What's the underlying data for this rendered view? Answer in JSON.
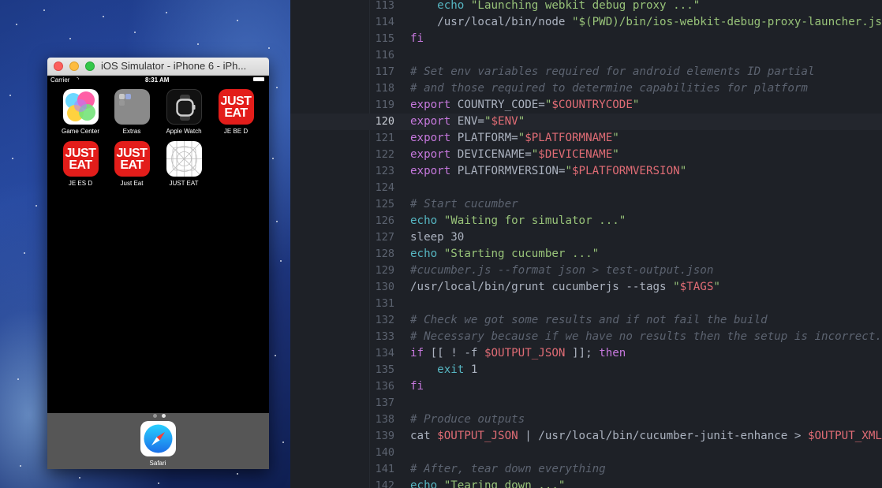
{
  "simulator": {
    "window_title": "iOS Simulator - iPhone 6 - iPh...",
    "status": {
      "carrier": "Carrier",
      "wifi": "◝",
      "time": "8:31 AM"
    },
    "apps": [
      {
        "label": "Game Center",
        "icon": "game-center-icon"
      },
      {
        "label": "Extras",
        "icon": "extras-folder-icon"
      },
      {
        "label": "Apple Watch",
        "icon": "apple-watch-icon"
      },
      {
        "label": "JE BE D",
        "icon": "just-eat-icon",
        "logo_text": [
          "JUST",
          "EAT"
        ]
      },
      {
        "label": "JE ES D",
        "icon": "just-eat-icon",
        "logo_text": [
          "JUST",
          "EAT"
        ]
      },
      {
        "label": "Just Eat",
        "icon": "just-eat-icon",
        "logo_text": [
          "JUST",
          "EAT"
        ]
      },
      {
        "label": "JUST EAT",
        "icon": "wireframe-app-icon"
      }
    ],
    "dock": [
      {
        "label": "Safari",
        "icon": "safari-icon"
      }
    ],
    "page_count": 2,
    "current_page": 2
  },
  "editor": {
    "active_line": 120,
    "lines": [
      {
        "n": "113",
        "tokens": [
          [
            "p",
            "    "
          ],
          [
            "cmd",
            "echo"
          ],
          [
            "p",
            " "
          ],
          [
            "str",
            "\"Launching webkit debug proxy ...\""
          ]
        ]
      },
      {
        "n": "114",
        "tokens": [
          [
            "p",
            "    /usr/local/bin/node "
          ],
          [
            "str",
            "\"$(PWD)/bin/ios-webkit-debug-proxy-launcher.js\""
          ],
          [
            "p",
            " > $"
          ]
        ]
      },
      {
        "n": "115",
        "tokens": [
          [
            "kw",
            "fi"
          ]
        ]
      },
      {
        "n": "116",
        "tokens": []
      },
      {
        "n": "117",
        "tokens": [
          [
            "com",
            "# Set env variables required for android elements ID partial"
          ]
        ]
      },
      {
        "n": "118",
        "tokens": [
          [
            "com",
            "# and those required to determine capabilities for platform"
          ]
        ]
      },
      {
        "n": "119",
        "tokens": [
          [
            "kw",
            "export"
          ],
          [
            "p",
            " COUNTRY_CODE="
          ],
          [
            "str",
            "\""
          ],
          [
            "var",
            "$COUNTRYCODE"
          ],
          [
            "str",
            "\""
          ]
        ]
      },
      {
        "n": "120",
        "tokens": [
          [
            "kw",
            "export"
          ],
          [
            "p",
            " ENV="
          ],
          [
            "str",
            "\""
          ],
          [
            "var",
            "$ENV"
          ],
          [
            "str",
            "\""
          ]
        ]
      },
      {
        "n": "121",
        "tokens": [
          [
            "kw",
            "export"
          ],
          [
            "p",
            " PLATFORM="
          ],
          [
            "str",
            "\""
          ],
          [
            "var",
            "$PLATFORMNAME"
          ],
          [
            "str",
            "\""
          ]
        ]
      },
      {
        "n": "122",
        "tokens": [
          [
            "kw",
            "export"
          ],
          [
            "p",
            " DEVICENAME="
          ],
          [
            "str",
            "\""
          ],
          [
            "var",
            "$DEVICENAME"
          ],
          [
            "str",
            "\""
          ]
        ]
      },
      {
        "n": "123",
        "tokens": [
          [
            "kw",
            "export"
          ],
          [
            "p",
            " PLATFORMVERSION="
          ],
          [
            "str",
            "\""
          ],
          [
            "var",
            "$PLATFORMVERSION"
          ],
          [
            "str",
            "\""
          ]
        ]
      },
      {
        "n": "124",
        "tokens": []
      },
      {
        "n": "125",
        "tokens": [
          [
            "com",
            "# Start cucumber"
          ]
        ]
      },
      {
        "n": "126",
        "tokens": [
          [
            "cmd",
            "echo"
          ],
          [
            "p",
            " "
          ],
          [
            "str",
            "\"Waiting for simulator ...\""
          ]
        ]
      },
      {
        "n": "127",
        "tokens": [
          [
            "p",
            "sleep 30"
          ]
        ]
      },
      {
        "n": "128",
        "tokens": [
          [
            "cmd",
            "echo"
          ],
          [
            "p",
            " "
          ],
          [
            "str",
            "\"Starting cucumber ...\""
          ]
        ]
      },
      {
        "n": "129",
        "tokens": [
          [
            "com",
            "#cucumber.js --format json > test-output.json"
          ]
        ]
      },
      {
        "n": "130",
        "tokens": [
          [
            "p",
            "/usr/local/bin/grunt cucumberjs --tags "
          ],
          [
            "str",
            "\""
          ],
          [
            "var",
            "$TAGS"
          ],
          [
            "str",
            "\""
          ]
        ]
      },
      {
        "n": "131",
        "tokens": []
      },
      {
        "n": "132",
        "tokens": [
          [
            "com",
            "# Check we got some results and if not fail the build"
          ]
        ]
      },
      {
        "n": "133",
        "tokens": [
          [
            "com",
            "# Necessary because if we have no results then the setup is incorrect."
          ]
        ]
      },
      {
        "n": "134",
        "tokens": [
          [
            "kw",
            "if"
          ],
          [
            "p",
            " [[ ! -f "
          ],
          [
            "var",
            "$OUTPUT_JSON"
          ],
          [
            "p",
            " ]]; "
          ],
          [
            "kw",
            "then"
          ]
        ]
      },
      {
        "n": "135",
        "tokens": [
          [
            "p",
            "    "
          ],
          [
            "cmd",
            "exit"
          ],
          [
            "p",
            " 1"
          ]
        ]
      },
      {
        "n": "136",
        "tokens": [
          [
            "kw",
            "fi"
          ]
        ]
      },
      {
        "n": "137",
        "tokens": []
      },
      {
        "n": "138",
        "tokens": [
          [
            "com",
            "# Produce outputs"
          ]
        ]
      },
      {
        "n": "139",
        "tokens": [
          [
            "p",
            "cat "
          ],
          [
            "var",
            "$OUTPUT_JSON"
          ],
          [
            "p",
            " | /usr/local/bin/cucumber-junit-enhance > "
          ],
          [
            "var",
            "$OUTPUT_XML"
          ]
        ]
      },
      {
        "n": "140",
        "tokens": []
      },
      {
        "n": "141",
        "tokens": [
          [
            "com",
            "# After, tear down everything"
          ]
        ]
      },
      {
        "n": "142",
        "tokens": [
          [
            "cmd",
            "echo"
          ],
          [
            "p",
            " "
          ],
          [
            "str",
            "\"Tearing down ...\""
          ]
        ]
      }
    ]
  }
}
